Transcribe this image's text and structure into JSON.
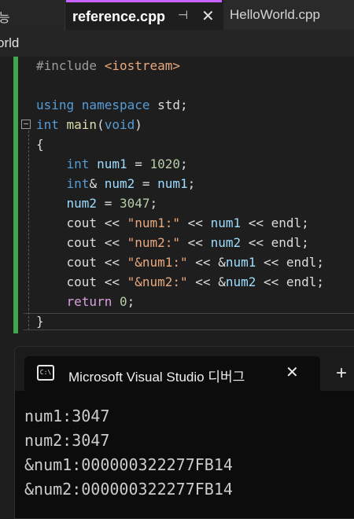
{
  "tabs": {
    "partial_label": "능",
    "active_label": "reference.cpp",
    "pin_glyph": "⊣",
    "close_glyph": "✕",
    "inactive_label": "HelloWorld.cpp"
  },
  "navbar": {
    "project": "orld"
  },
  "editor": {
    "fold_glyph": "−",
    "lines": [
      [
        {
          "t": "#include ",
          "c": "pp"
        },
        {
          "t": "<iostream>",
          "c": "str"
        }
      ],
      [],
      [
        {
          "t": "using ",
          "c": "kw"
        },
        {
          "t": "namespace ",
          "c": "kw"
        },
        {
          "t": "std;",
          "c": "punc"
        }
      ],
      [
        {
          "t": "int ",
          "c": "kw"
        },
        {
          "t": "main",
          "c": "fn"
        },
        {
          "t": "(",
          "c": "punc"
        },
        {
          "t": "void",
          "c": "kw"
        },
        {
          "t": ")",
          "c": "punc"
        }
      ],
      [
        {
          "t": "{",
          "c": "punc"
        }
      ],
      [
        {
          "t": "    ",
          "c": "punc"
        },
        {
          "t": "int ",
          "c": "kw"
        },
        {
          "t": "num1",
          "c": "var"
        },
        {
          "t": " = ",
          "c": "punc"
        },
        {
          "t": "1020",
          "c": "num"
        },
        {
          "t": ";",
          "c": "punc"
        }
      ],
      [
        {
          "t": "    ",
          "c": "punc"
        },
        {
          "t": "int",
          "c": "kw"
        },
        {
          "t": "& ",
          "c": "punc"
        },
        {
          "t": "num2",
          "c": "var"
        },
        {
          "t": " = ",
          "c": "punc"
        },
        {
          "t": "num1",
          "c": "var"
        },
        {
          "t": ";",
          "c": "punc"
        }
      ],
      [
        {
          "t": "    ",
          "c": "punc"
        },
        {
          "t": "num2",
          "c": "var"
        },
        {
          "t": " = ",
          "c": "punc"
        },
        {
          "t": "3047",
          "c": "num"
        },
        {
          "t": ";",
          "c": "punc"
        }
      ],
      [
        {
          "t": "    cout << ",
          "c": "punc"
        },
        {
          "t": "\"num1:\"",
          "c": "str"
        },
        {
          "t": " << ",
          "c": "punc"
        },
        {
          "t": "num1",
          "c": "var"
        },
        {
          "t": " << endl;",
          "c": "punc"
        }
      ],
      [
        {
          "t": "    cout << ",
          "c": "punc"
        },
        {
          "t": "\"num2:\"",
          "c": "str"
        },
        {
          "t": " << ",
          "c": "punc"
        },
        {
          "t": "num2",
          "c": "var"
        },
        {
          "t": " << endl;",
          "c": "punc"
        }
      ],
      [
        {
          "t": "    cout << ",
          "c": "punc"
        },
        {
          "t": "\"&num1:\"",
          "c": "str"
        },
        {
          "t": " << &",
          "c": "punc"
        },
        {
          "t": "num1",
          "c": "var"
        },
        {
          "t": " << endl;",
          "c": "punc"
        }
      ],
      [
        {
          "t": "    cout << ",
          "c": "punc"
        },
        {
          "t": "\"&num2:\"",
          "c": "str"
        },
        {
          "t": " << &",
          "c": "punc"
        },
        {
          "t": "num2",
          "c": "var"
        },
        {
          "t": " << endl;",
          "c": "punc"
        }
      ],
      [
        {
          "t": "    ",
          "c": "punc"
        },
        {
          "t": "return ",
          "c": "ctl"
        },
        {
          "t": "0",
          "c": "num"
        },
        {
          "t": ";",
          "c": "punc"
        }
      ],
      [
        {
          "t": "}",
          "c": "punc"
        }
      ]
    ]
  },
  "terminal": {
    "icon_text": "C:\\",
    "title": "Microsoft Visual Studio 디버그",
    "close_glyph": "✕",
    "add_glyph": "+",
    "output": [
      "num1:3047",
      "num2:3047",
      "&num1:000000322277FB14",
      "&num2:000000322277FB14"
    ]
  }
}
